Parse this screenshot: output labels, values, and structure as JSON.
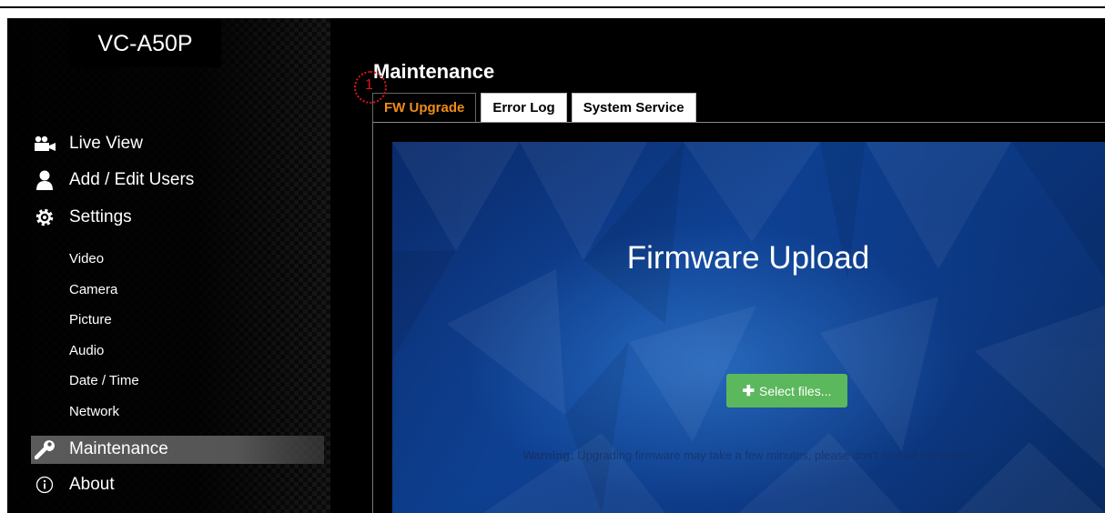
{
  "header": {
    "model": "VC-A50P"
  },
  "sidebar": {
    "items": [
      {
        "label": "Live View",
        "icon": "video-camera-icon"
      },
      {
        "label": "Add / Edit Users",
        "icon": "user-icon"
      },
      {
        "label": "Settings",
        "icon": "gear-icon"
      }
    ],
    "settings_sub": [
      "Video",
      "Camera",
      "Picture",
      "Audio",
      "Date / Time",
      "Network"
    ],
    "maintenance": {
      "label": "Maintenance",
      "icon": "wrench-icon"
    },
    "about": {
      "label": "About",
      "icon": "info-icon"
    }
  },
  "main": {
    "title": "Maintenance",
    "tabs": [
      "FW Upgrade",
      "Error Log",
      "System Service"
    ],
    "active_tab": "FW Upgrade",
    "callout": "1",
    "panel": {
      "title": "Firmware Upload",
      "select_button": "Select files...",
      "warning_label": "Warning:",
      "warning_text": "Upgrading firmware may take a few minutes, please don't turn off the power"
    }
  },
  "colors": {
    "accent_tab": "#f08c1a",
    "button_green": "#5cb85c",
    "callout_red": "#e0141e"
  }
}
